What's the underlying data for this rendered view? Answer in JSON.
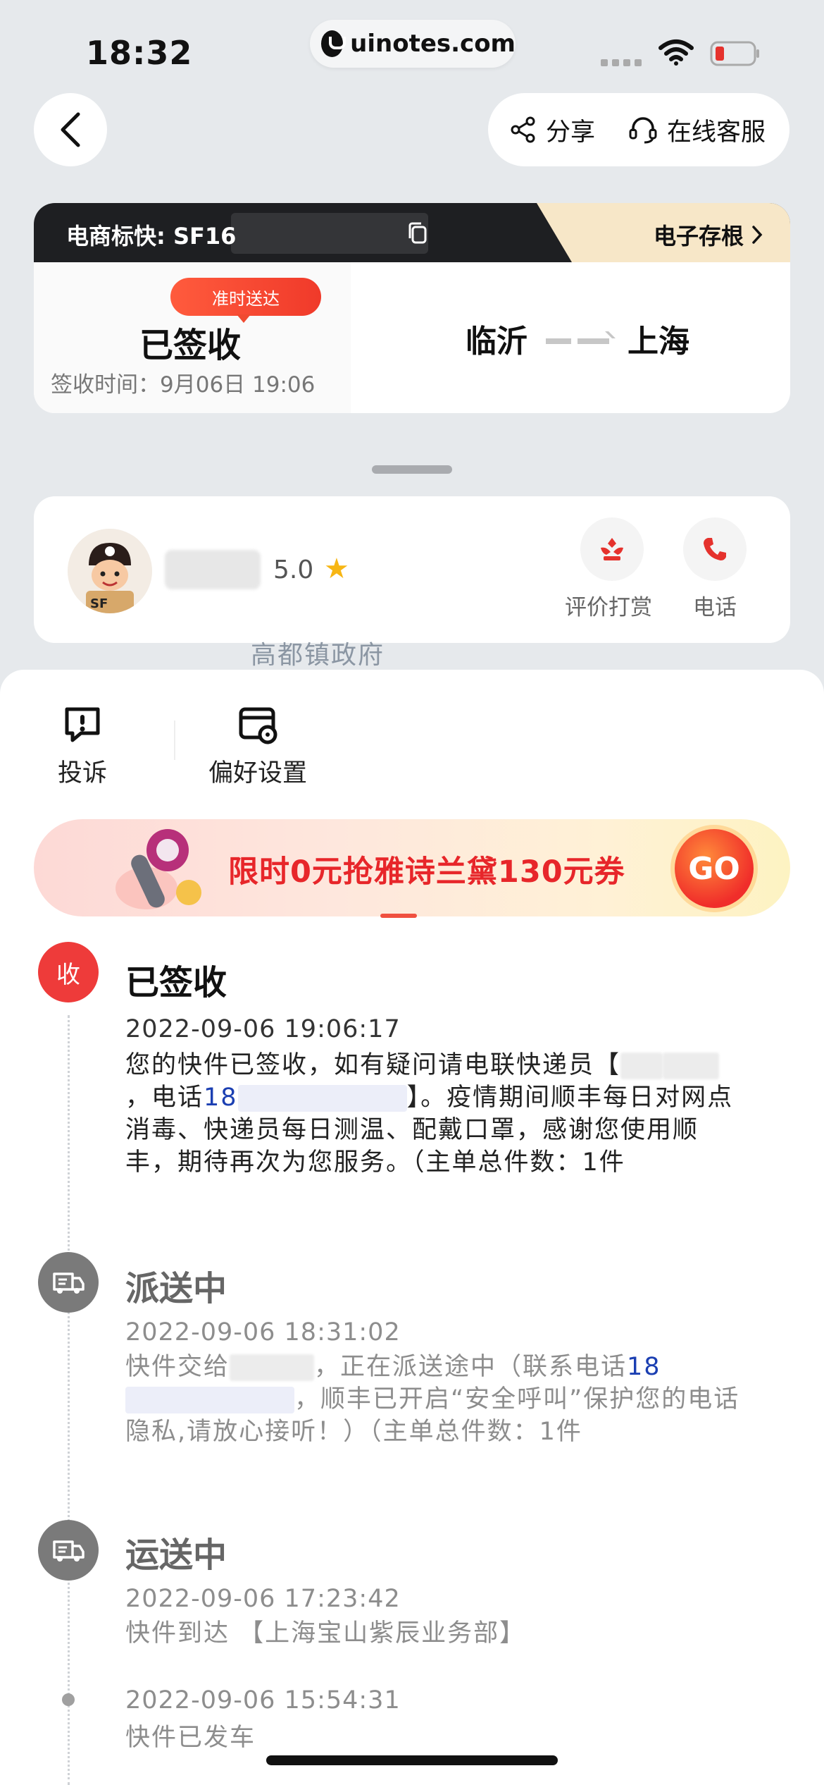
{
  "status_bar": {
    "time": "18:32",
    "url": "uinotes.com"
  },
  "nav": {
    "share_label": "分享",
    "service_label": "在线客服"
  },
  "shipment": {
    "tracking_prefix": "电商标快: SF16",
    "receipt_label": "电子存根",
    "badge": "准时送达",
    "status": "已签收",
    "signed_time": "签收时间：9月06日 19:06",
    "origin": "临沂",
    "destination": "上海"
  },
  "courier": {
    "rating": "5.0",
    "reward_label": "评价打赏",
    "phone_label": "电话"
  },
  "map_label": "高都镇政府",
  "tools": {
    "complaint": "投诉",
    "preferences": "偏好设置"
  },
  "banner": {
    "text": "限时0元抢雅诗兰黛130元券",
    "go": "GO"
  },
  "timeline": [
    {
      "node": "收",
      "title": "已签收",
      "time": "2022-09-06 19:06:17",
      "body_1": "您的快件已签收，如有疑问请电联快递员【",
      "body_2": "，电话",
      "phone_prefix": "18",
      "body_3": "】。疫情期间顺丰每日对网点消毒、快递员每日测温、配戴口罩，感谢您使用顺丰，期待再次为您服务。（主单总件数：1件"
    },
    {
      "title": "派送中",
      "time": "2022-09-06 18:31:02",
      "body_1": "快件交给",
      "body_2": "，正在派送途中（联系电话",
      "phone_prefix": "18",
      "body_3": "，顺丰已开启“安全呼叫”保护您的电话隐私,请放心接听！）（主单总件数：1件"
    },
    {
      "title": "运送中",
      "time": "2022-09-06 17:23:42",
      "body": "快件到达 【上海宝山紫辰业务部】"
    },
    {
      "time": "2022-09-06 15:54:31",
      "body": "快件已发车"
    }
  ]
}
